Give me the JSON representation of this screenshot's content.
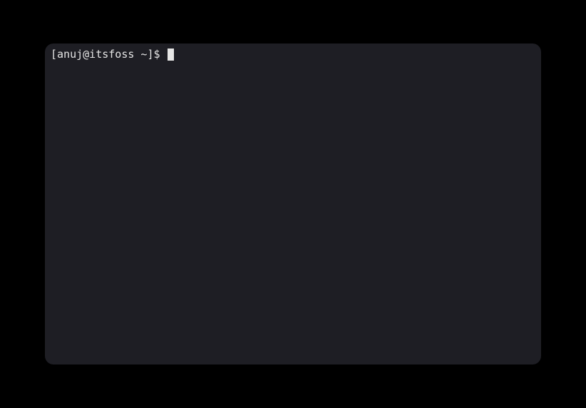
{
  "terminal": {
    "prompt": "[anuj@itsfoss ~]$ "
  }
}
